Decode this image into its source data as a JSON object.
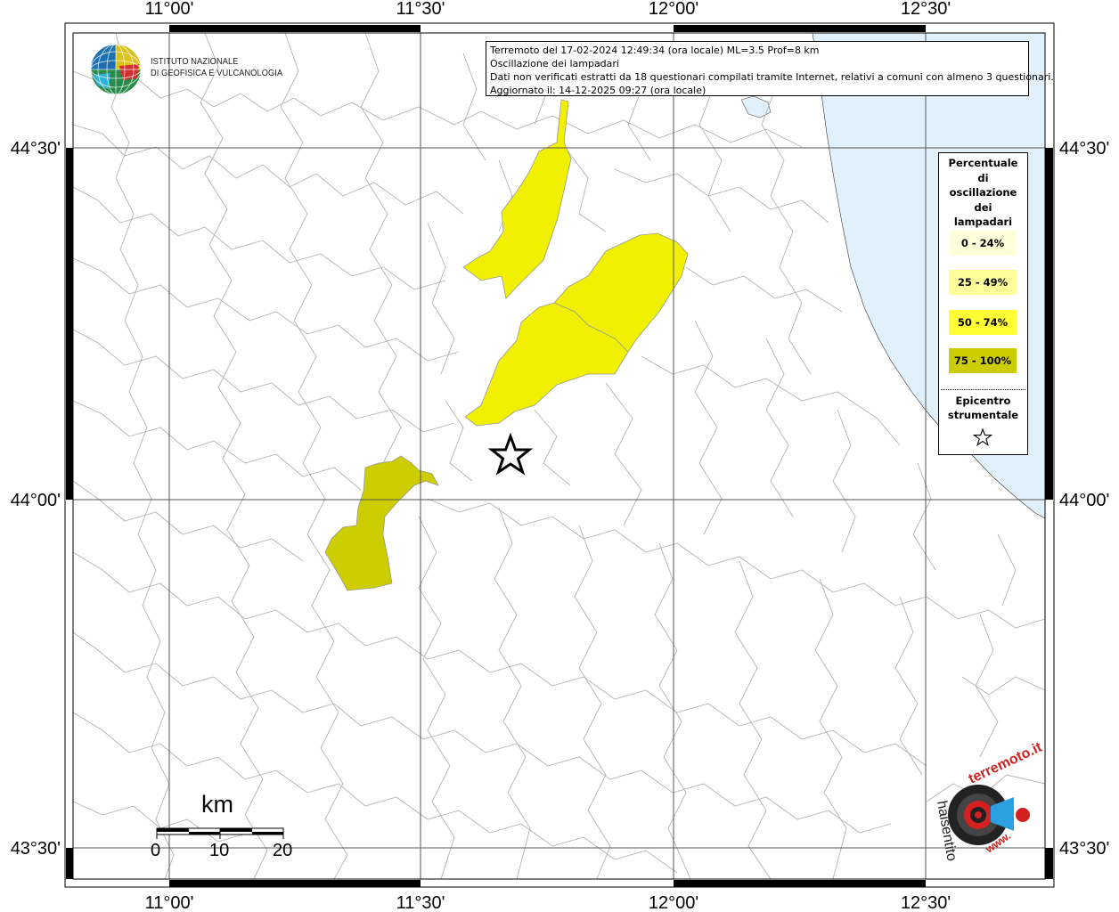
{
  "header": {
    "line1": "Terremoto del 17-02-2024 12:49:34 (ora locale) ML=3.5 Prof=8 km",
    "line2": "Oscillazione dei lampadari",
    "line3": "Dati non verificati estratti da 18 questionari compilati tramite Internet, relativi a comuni con almeno 3 questionari.",
    "line4": "Aggiornato il: 14-12-2025 09:27 (ora locale)"
  },
  "institute": {
    "line1": "ISTITUTO NAZIONALE",
    "line2": "DI GEOFISICA E VULCANOLOGIA"
  },
  "longitude_labels": [
    "11°00'",
    "11°30'",
    "12°00'",
    "12°30'"
  ],
  "latitude_labels": [
    "44°30'",
    "44°00'",
    "43°30'"
  ],
  "legend": {
    "title": [
      "Percentuale",
      "di",
      "oscillazione",
      "dei",
      "lampadari"
    ],
    "classes": [
      {
        "label": "0 - 24%",
        "color": "#ffffd9"
      },
      {
        "label": "25 - 49%",
        "color": "#ffff99"
      },
      {
        "label": "50 - 74%",
        "color": "#ffff33"
      },
      {
        "label": "75 - 100%",
        "color": "#cccc00"
      }
    ],
    "epicenter": [
      "Epicentro",
      "strumentale"
    ]
  },
  "scale": {
    "unit": "km",
    "ticks": [
      "0",
      "10",
      "20"
    ]
  },
  "colors": {
    "sea": "#e1f0fb",
    "class_50_74": "#f0f000",
    "class_75_100": "#cdcd00"
  },
  "logo_hsit": {
    "text_top": "terremoto.it",
    "text_side": "haisentito",
    "text_bottom": "www."
  }
}
